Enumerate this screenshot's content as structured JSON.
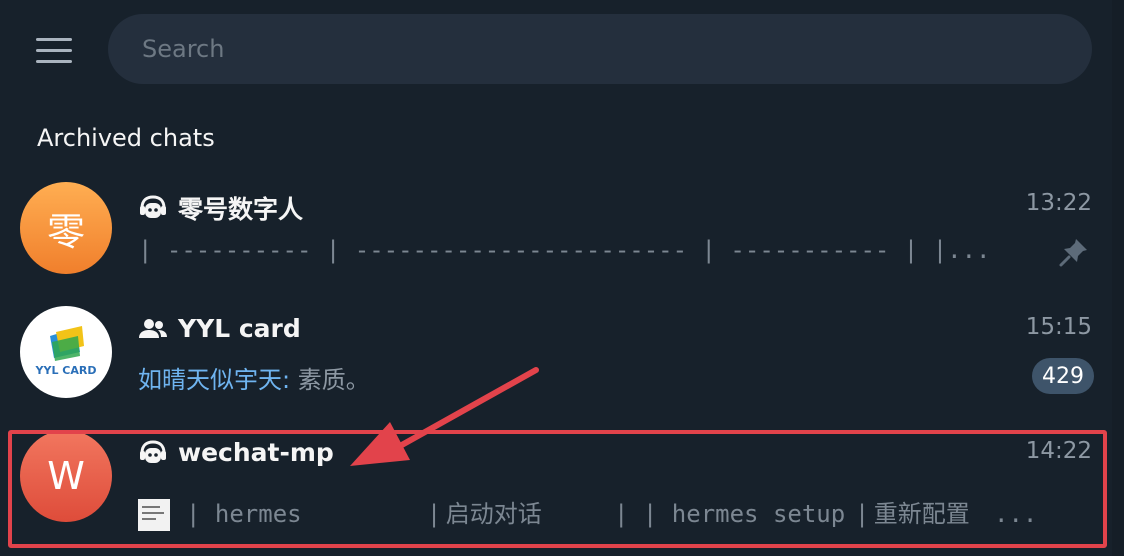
{
  "search": {
    "placeholder": "Search"
  },
  "section_title": "Archived chats",
  "chats": [
    {
      "avatar_text": "零",
      "avatar_color": "#f59a3f",
      "type_icon": "bot-icon",
      "title": "零号数字人",
      "time": "13:22",
      "preview": "| ---------- | ----------------------- | ----------- | |...",
      "pinned": true
    },
    {
      "avatar_text": "YYL CARD",
      "avatar_color": "#ffffff",
      "type_icon": "group-icon",
      "title": "YYL card",
      "time": "15:15",
      "sender": "如晴天似宇天:",
      "preview": " 素质。",
      "unread": "429"
    },
    {
      "avatar_text": "W",
      "avatar_color": "#e55a45",
      "type_icon": "bot-icon",
      "title": "wechat-mp",
      "time": "14:22",
      "preview_parts": [
        "| hermes",
        "| 启动对话",
        "| | hermes setup",
        "| 重新配置",
        "..."
      ]
    }
  ],
  "colors": {
    "background": "#17212b",
    "search_bg": "#242f3d",
    "accent_blue": "#6fb4f0",
    "annotation_red": "#e2434b",
    "badge_bg": "#3e546a"
  }
}
